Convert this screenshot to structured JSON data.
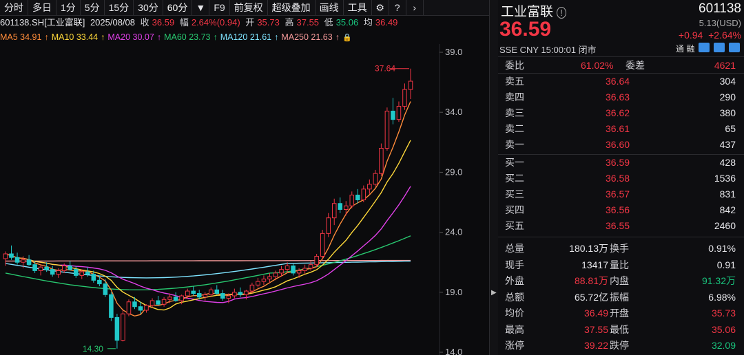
{
  "toolbar": {
    "items": [
      "分时",
      "多日",
      "1分",
      "5分",
      "15分",
      "30分",
      "60分",
      "F9",
      "前复权",
      "超级叠加",
      "画线",
      "工具"
    ],
    "dropdown_icon": "caret-down-icon",
    "icons": [
      "gear-icon",
      "help-icon",
      "chevron-right-icon"
    ]
  },
  "info": {
    "symbol": "601138.SH[工业富联]",
    "date": "2025/08/08",
    "close_label": "收",
    "close": "36.59",
    "range_label": "幅",
    "range": "2.64%(0.94)",
    "open_label": "开",
    "open": "35.73",
    "high_label": "高",
    "high": "37.55",
    "low_label": "低",
    "low": "35.06",
    "avg_label": "均",
    "avg": "36.49"
  },
  "ma": [
    {
      "label": "MA5 34.91",
      "color": "#ff8c3a"
    },
    {
      "label": "MA10 33.44",
      "color": "#ffd93a"
    },
    {
      "label": "MA20 30.07",
      "color": "#e040e8"
    },
    {
      "label": "MA60 23.73",
      "color": "#28c76f"
    },
    {
      "label": "MA120 21.61",
      "color": "#7fe4ff"
    },
    {
      "label": "MA250 21.63",
      "color": "#f49a9a"
    }
  ],
  "chart_data": {
    "type": "candlestick",
    "y_ticks": [
      "39.0",
      "34.0",
      "29.0",
      "24.0",
      "19.0",
      "14.0"
    ],
    "ylim": [
      14,
      39
    ],
    "max_label": "37.64",
    "min_label": "14.30",
    "candles": [
      [
        21.8,
        22.4,
        21.2,
        22.2
      ],
      [
        22.2,
        22.9,
        21.7,
        21.9
      ],
      [
        21.9,
        22.3,
        21.3,
        21.5
      ],
      [
        21.5,
        22.0,
        21.0,
        21.7
      ],
      [
        21.7,
        22.1,
        21.2,
        21.3
      ],
      [
        21.3,
        21.6,
        20.6,
        20.8
      ],
      [
        20.8,
        21.3,
        20.4,
        21.1
      ],
      [
        21.1,
        21.5,
        20.7,
        20.9
      ],
      [
        20.9,
        21.2,
        20.3,
        20.5
      ],
      [
        20.5,
        21.0,
        20.2,
        20.8
      ],
      [
        20.8,
        21.4,
        20.6,
        21.2
      ],
      [
        21.2,
        21.6,
        20.8,
        20.9
      ],
      [
        20.9,
        21.2,
        20.2,
        20.4
      ],
      [
        20.4,
        20.9,
        20.1,
        20.7
      ],
      [
        20.7,
        21.1,
        20.3,
        20.5
      ],
      [
        20.5,
        20.8,
        19.8,
        20.0
      ],
      [
        20.0,
        20.4,
        19.5,
        19.7
      ],
      [
        19.7,
        20.1,
        18.6,
        18.8
      ],
      [
        18.8,
        19.0,
        16.6,
        16.9
      ],
      [
        16.9,
        17.2,
        14.3,
        15.0
      ],
      [
        15.0,
        17.5,
        14.9,
        17.2
      ],
      [
        17.2,
        18.4,
        17.0,
        18.2
      ],
      [
        18.2,
        18.6,
        17.6,
        17.8
      ],
      [
        17.8,
        18.2,
        17.2,
        17.5
      ],
      [
        17.5,
        18.0,
        17.3,
        17.9
      ],
      [
        17.9,
        18.5,
        17.7,
        18.3
      ],
      [
        18.3,
        18.7,
        17.9,
        18.0
      ],
      [
        18.0,
        18.6,
        17.8,
        18.4
      ],
      [
        18.4,
        18.9,
        18.1,
        18.6
      ],
      [
        18.6,
        19.0,
        18.2,
        18.3
      ],
      [
        18.3,
        18.8,
        18.0,
        18.7
      ],
      [
        18.7,
        19.3,
        18.5,
        19.1
      ],
      [
        19.1,
        19.5,
        18.7,
        18.9
      ],
      [
        18.9,
        19.2,
        18.4,
        18.6
      ],
      [
        18.6,
        19.0,
        18.3,
        18.8
      ],
      [
        18.8,
        19.4,
        18.6,
        19.2
      ],
      [
        19.2,
        19.6,
        18.8,
        18.9
      ],
      [
        18.9,
        19.2,
        18.3,
        18.5
      ],
      [
        18.5,
        18.9,
        18.1,
        18.7
      ],
      [
        18.7,
        19.3,
        18.5,
        19.0
      ],
      [
        19.0,
        19.4,
        18.6,
        18.8
      ],
      [
        18.8,
        19.2,
        18.4,
        19.1
      ],
      [
        19.1,
        19.8,
        18.9,
        19.6
      ],
      [
        19.6,
        20.2,
        19.4,
        19.9
      ],
      [
        19.9,
        20.4,
        19.6,
        20.1
      ],
      [
        20.1,
        20.6,
        19.8,
        20.3
      ],
      [
        20.3,
        20.8,
        20.0,
        20.6
      ],
      [
        20.6,
        21.2,
        20.3,
        20.9
      ],
      [
        20.9,
        21.5,
        20.6,
        21.2
      ],
      [
        21.2,
        21.4,
        20.4,
        20.6
      ],
      [
        20.6,
        21.0,
        20.2,
        20.8
      ],
      [
        20.8,
        21.3,
        20.5,
        21.0
      ],
      [
        21.0,
        21.6,
        20.8,
        21.3
      ],
      [
        21.3,
        22.2,
        21.1,
        22.0
      ],
      [
        22.0,
        24.2,
        21.8,
        23.9
      ],
      [
        23.9,
        25.6,
        23.6,
        25.2
      ],
      [
        25.2,
        26.8,
        24.6,
        26.4
      ],
      [
        26.4,
        26.9,
        25.6,
        25.9
      ],
      [
        25.9,
        26.6,
        25.4,
        26.2
      ],
      [
        26.2,
        27.4,
        26.0,
        27.1
      ],
      [
        27.1,
        27.6,
        26.4,
        26.7
      ],
      [
        26.7,
        27.9,
        26.5,
        27.6
      ],
      [
        27.6,
        28.4,
        27.2,
        28.0
      ],
      [
        28.0,
        29.2,
        27.8,
        28.9
      ],
      [
        28.9,
        31.4,
        28.7,
        31.0
      ],
      [
        31.0,
        34.4,
        30.8,
        34.1
      ],
      [
        34.1,
        35.2,
        33.0,
        33.4
      ],
      [
        33.4,
        34.9,
        33.2,
        34.5
      ],
      [
        34.5,
        36.4,
        34.2,
        35.9
      ],
      [
        35.9,
        37.64,
        35.1,
        36.59
      ]
    ]
  },
  "quote": {
    "name": "工业富联",
    "info_icon": "info-icon",
    "code": "601138",
    "price": "36.59",
    "usd": "5.13(USD)",
    "change": "+0.94",
    "change_pct": "+2.64%",
    "meta": "SSE  CNY  15:00:01  闭市",
    "tags_label": "通 融",
    "webi_ratio_label": "委比",
    "webi_ratio": "61.02%",
    "webi_diff_label": "委差",
    "webi_diff": "4621"
  },
  "book": {
    "asks": [
      {
        "label": "卖五",
        "price": "36.64",
        "vol": "304"
      },
      {
        "label": "卖四",
        "price": "36.63",
        "vol": "290"
      },
      {
        "label": "卖三",
        "price": "36.62",
        "vol": "380"
      },
      {
        "label": "卖二",
        "price": "36.61",
        "vol": "65"
      },
      {
        "label": "卖一",
        "price": "36.60",
        "vol": "437"
      }
    ],
    "bids": [
      {
        "label": "买一",
        "price": "36.59",
        "vol": "428"
      },
      {
        "label": "买二",
        "price": "36.58",
        "vol": "1536"
      },
      {
        "label": "买三",
        "price": "36.57",
        "vol": "831"
      },
      {
        "label": "买四",
        "price": "36.56",
        "vol": "842"
      },
      {
        "label": "买五",
        "price": "36.55",
        "vol": "2460"
      }
    ]
  },
  "stats": [
    {
      "l1": "总量",
      "v1": "180.13万",
      "c1": "white",
      "l2": "换手",
      "v2": "0.91%",
      "c2": "white"
    },
    {
      "l1": "现手",
      "v1": "13417",
      "c1": "white",
      "l2": "量比",
      "v2": "0.91",
      "c2": "white"
    },
    {
      "l1": "外盘",
      "v1": "88.81万",
      "c1": "red",
      "l2": "内盘",
      "v2": "91.32万",
      "c2": "green"
    },
    {
      "l1": "总额",
      "v1": "65.72亿",
      "c1": "white",
      "l2": "振幅",
      "v2": "6.98%",
      "c2": "white"
    },
    {
      "l1": "均价",
      "v1": "36.49",
      "c1": "red",
      "l2": "开盘",
      "v2": "35.73",
      "c2": "red"
    },
    {
      "l1": "最高",
      "v1": "37.55",
      "c1": "red",
      "l2": "最低",
      "v2": "35.06",
      "c2": "red"
    },
    {
      "l1": "涨停",
      "v1": "39.22",
      "c1": "red",
      "l2": "跌停",
      "v2": "32.09",
      "c2": "green"
    }
  ]
}
